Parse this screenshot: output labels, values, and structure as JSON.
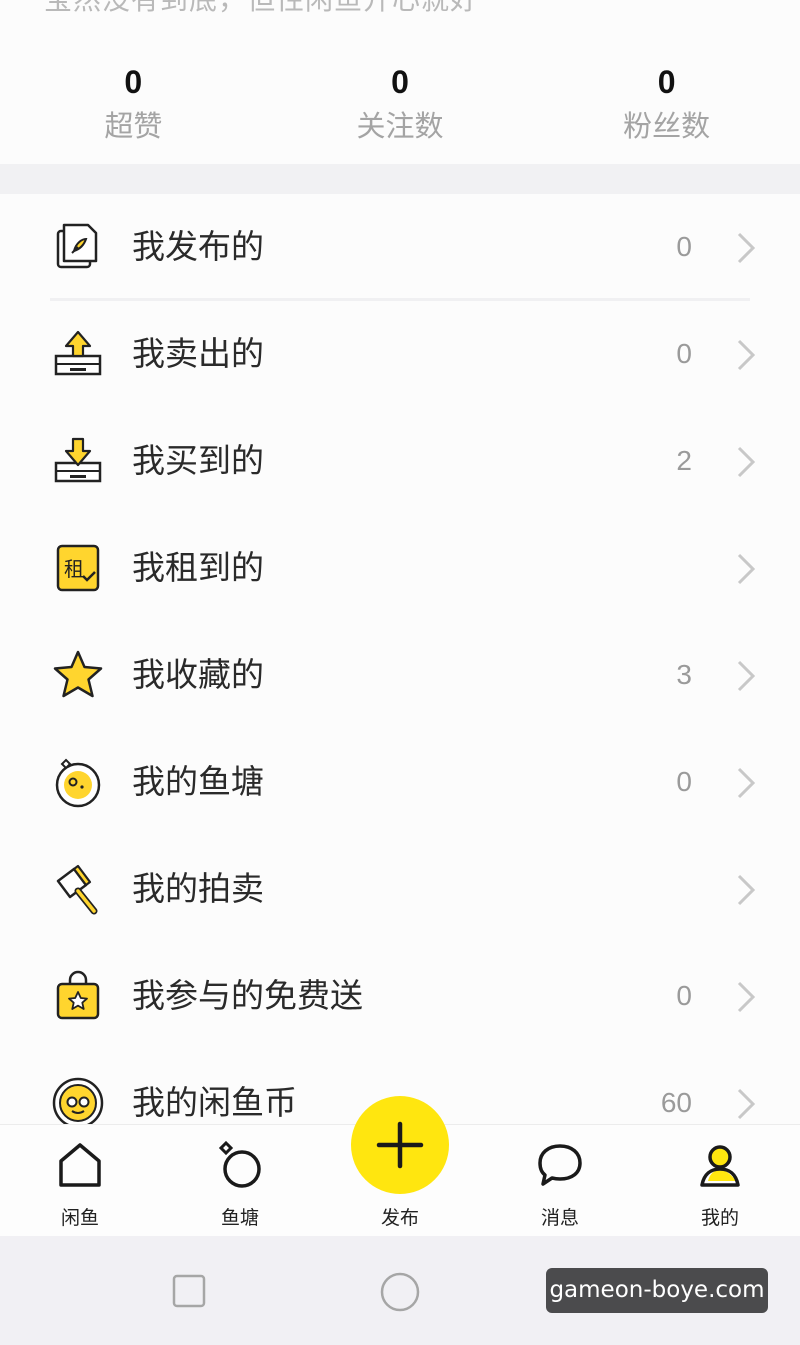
{
  "top_partial_text": "宝然没有到底，但性闲鱼开心就好",
  "stats": [
    {
      "value": "0",
      "label": "超赞"
    },
    {
      "value": "0",
      "label": "关注数"
    },
    {
      "value": "0",
      "label": "粉丝数"
    }
  ],
  "menu": [
    {
      "label": "我发布的",
      "count": "0",
      "icon": "published-doc-icon"
    },
    {
      "label": "我卖出的",
      "count": "0",
      "icon": "sold-tray-icon"
    },
    {
      "label": "我买到的",
      "count": "2",
      "icon": "bought-tray-icon"
    },
    {
      "label": "我租到的",
      "count": "",
      "icon": "rent-icon",
      "icon_text": "租"
    },
    {
      "label": "我收藏的",
      "count": "3",
      "icon": "star-icon"
    },
    {
      "label": "我的鱼塘",
      "count": "0",
      "icon": "fishpond-icon"
    },
    {
      "label": "我的拍卖",
      "count": "",
      "icon": "auction-hammer-icon"
    },
    {
      "label": "我参与的免费送",
      "count": "0",
      "icon": "free-gift-bag-icon"
    },
    {
      "label": "我的闲鱼币",
      "count": "60",
      "icon": "xianyu-coin-icon"
    }
  ],
  "tabs": [
    {
      "label": "闲鱼",
      "icon": "home-icon"
    },
    {
      "label": "鱼塘",
      "icon": "fishpond-ring-icon"
    },
    {
      "label": "发布",
      "icon": "plus-icon"
    },
    {
      "label": "消息",
      "icon": "message-bubble-icon"
    },
    {
      "label": "我的",
      "icon": "profile-icon"
    }
  ],
  "system_nav": [
    "square-button",
    "circle-button",
    "back-button"
  ],
  "watermark": "gameon-boye.com",
  "colors": {
    "accent": "#ffe60f",
    "text": "#222222",
    "muted": "#a4a4a4"
  }
}
